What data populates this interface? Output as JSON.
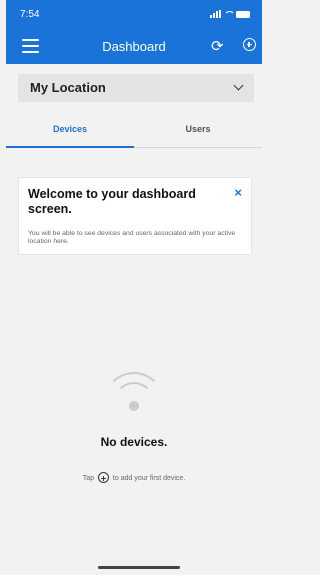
{
  "status_bar": {
    "time": "7:54"
  },
  "app_bar": {
    "title": "Dashboard",
    "refresh_icon": "refresh-icon",
    "add_icon": "add-circle-icon"
  },
  "location": {
    "label": "My Location"
  },
  "tabs": [
    {
      "label": "Devices",
      "active": true
    },
    {
      "label": "Users",
      "active": false
    }
  ],
  "welcome": {
    "title": "Welcome to your dashboard screen.",
    "body": "You will be able to see devices and users associated with your active location here.",
    "close_symbol": "×"
  },
  "empty": {
    "title": "No devices.",
    "hint_before": "Tap",
    "hint_after": "to add your first device."
  },
  "colors": {
    "accent": "#1a73d9",
    "background": "#f2f2f2",
    "card": "#ffffff"
  }
}
